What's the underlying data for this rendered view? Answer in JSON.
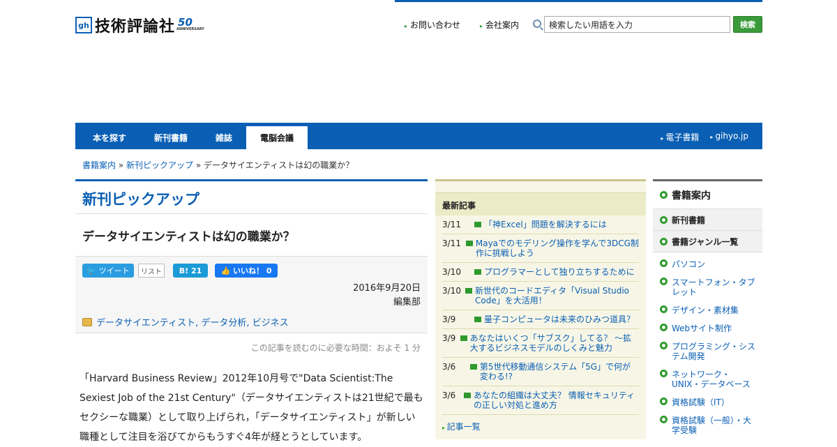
{
  "header": {
    "logo_mark": "gh",
    "logo_text": "技術評論社",
    "logo_50": "50",
    "logo_50_sub": "ANNIVERSARY",
    "links": [
      "お問い合わせ",
      "会社案内"
    ],
    "search_value": "検索したい用語を入力",
    "search_button": "検索"
  },
  "nav": {
    "items": [
      "本を探す",
      "新刊書籍",
      "雑誌",
      "電脳会議"
    ],
    "right": [
      "電子書籍",
      "gihyo.jp"
    ]
  },
  "breadcrumb": [
    "書籍案内",
    "新刊ピックアップ",
    "データサイエンティストは幻の職業か？"
  ],
  "breadcrumb_sep": "»",
  "main": {
    "section_title": "新刊ピックアップ",
    "article_title": "データサイエンティストは幻の職業か？",
    "share": {
      "tweet": "ツイート",
      "list": "リスト",
      "hatena": "B! 21",
      "like": "いいね！ 0"
    },
    "date": "2016年9月20日",
    "author": "編集部",
    "tags": "データサイエンティスト, データ分析, ビジネス",
    "read_time": "この記事を読むのに必要な時間：およそ 1 分",
    "body": "「Harvard Business Review」2012年10月号で\"Data Scientist:The Sexiest Job of the 21st Century\"（データサイエンティストは21世紀で最もセクシーな職業）として取り上げられ，「データサイエンティスト」が新しい職種として注目を浴びてからもうすぐ4年が経とうとしています。"
  },
  "news": {
    "heading": "最新記事",
    "items": [
      {
        "date": "3/11",
        "title": "「神Excel」問題を解決するには"
      },
      {
        "date": "3/11",
        "title": "Mayaでのモデリング操作を学んで3DCG制作に挑戦しよう"
      },
      {
        "date": "3/10",
        "title": "プログラマーとして独り立ちするために"
      },
      {
        "date": "3/10",
        "title": "新世代のコードエディタ「Visual Studio Code」を大活用！"
      },
      {
        "date": "3/9",
        "title": "量子コンピュータは未来のひみつ道具？"
      },
      {
        "date": "3/9",
        "title": "あなたはいくつ「サブスク」してる？ ～拡大するビジネスモデルのしくみと魅力"
      },
      {
        "date": "3/6",
        "title": "第5世代移動通信システム「5G」で何が変わる!?"
      },
      {
        "date": "3/6",
        "title": "あなたの組織は大丈夫？ 情報セキュリティの正しい対処と進め方"
      }
    ],
    "more": "記事一覧"
  },
  "side": {
    "heading": "書籍案内",
    "sub": [
      "新刊書籍",
      "書籍ジャンル一覧"
    ],
    "genres": [
      "パソコン",
      "スマートフォン・タブレット",
      "デザイン・素材集",
      "Webサイト制作",
      "プログラミング・システム開発",
      "ネットワーク・UNIX・データベース",
      "資格試験（IT）",
      "資格試験（一般）・大学受験"
    ]
  }
}
